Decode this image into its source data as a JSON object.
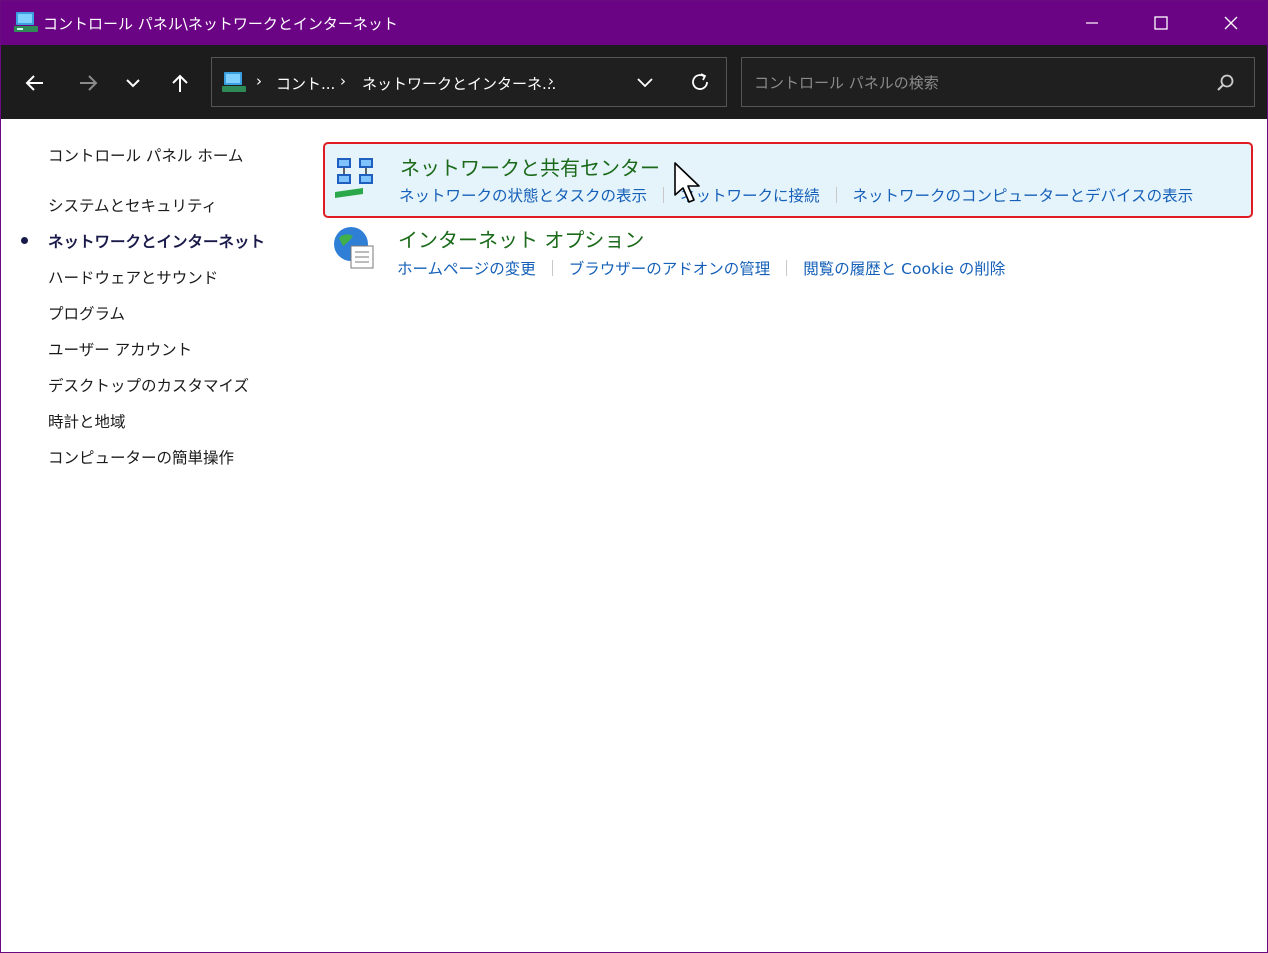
{
  "window": {
    "title": "コントロール パネル\\ネットワークとインターネット",
    "accent_color": "#6b0484"
  },
  "address_bar": {
    "crumbs": [
      "コント...",
      "ネットワークとインターネ..."
    ]
  },
  "search": {
    "placeholder": "コントロール パネルの検索",
    "value": ""
  },
  "sidebar": {
    "items": [
      {
        "label": "コントロール パネル ホーム",
        "active": false
      },
      {
        "label": "システムとセキュリティ",
        "active": false
      },
      {
        "label": "ネットワークとインターネット",
        "active": true
      },
      {
        "label": "ハードウェアとサウンド",
        "active": false
      },
      {
        "label": "プログラム",
        "active": false
      },
      {
        "label": "ユーザー アカウント",
        "active": false
      },
      {
        "label": "デスクトップのカスタマイズ",
        "active": false
      },
      {
        "label": "時計と地域",
        "active": false
      },
      {
        "label": "コンピューターの簡単操作",
        "active": false
      }
    ]
  },
  "categories": [
    {
      "title": "ネットワークと共有センター",
      "icon": "network-sharing-icon",
      "highlighted": true,
      "links": [
        "ネットワークの状態とタスクの表示",
        "ネットワークに接続",
        "ネットワークのコンピューターとデバイスの表示"
      ]
    },
    {
      "title": "インターネット オプション",
      "icon": "internet-options-icon",
      "highlighted": false,
      "links": [
        "ホームページの変更",
        "ブラウザーのアドオンの管理",
        "閲覧の履歴と Cookie の削除"
      ]
    }
  ]
}
